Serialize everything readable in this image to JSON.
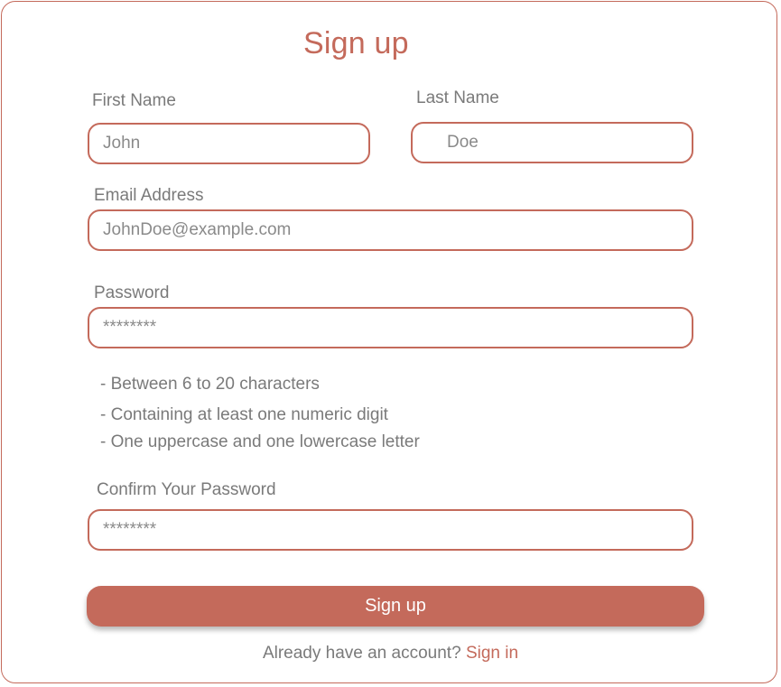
{
  "title": "Sign up",
  "first_name": {
    "label": "First Name",
    "value": "John"
  },
  "last_name": {
    "label": "Last Name",
    "value": "Doe"
  },
  "email": {
    "label": "Email Address",
    "value": "JohnDoe@example.com"
  },
  "password": {
    "label": "Password",
    "value": "********",
    "rules": [
      "- Between 6 to 20 characters",
      "- Containing at least one numeric digit",
      "- One uppercase and one lowercase letter"
    ]
  },
  "confirm_password": {
    "label": "Confirm Your Password",
    "value": "********"
  },
  "submit_label": "Sign up",
  "footer": {
    "prompt": "Already have an account?",
    "link": "Sign in"
  },
  "colors": {
    "accent": "#c46a5b",
    "text": "#7a7a7a",
    "background": "#ffffff"
  }
}
